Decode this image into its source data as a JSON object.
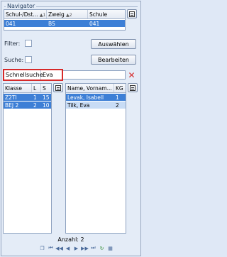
{
  "navigator": {
    "title": "Navigator"
  },
  "top_table": {
    "columns": [
      {
        "label": "Schul-/Dst...",
        "sort": "▲1"
      },
      {
        "label": "Zweig",
        "sort": "▲2"
      },
      {
        "label": "Schule",
        "sort": ""
      }
    ],
    "row": [
      "041",
      "BS",
      "041"
    ]
  },
  "filter": {
    "label": "Filter:",
    "button": "Auswählen"
  },
  "suche": {
    "label": "Suche:",
    "button": "Bearbeiten"
  },
  "schnellsuche": {
    "label": "Schnellsuche",
    "value": "Eva"
  },
  "klassen_table": {
    "columns": [
      {
        "label": "Klasse"
      },
      {
        "label": "L"
      },
      {
        "label": "S"
      }
    ],
    "rows": [
      [
        "Z2TI",
        "1",
        "15"
      ],
      [
        "BEJ 2",
        "2",
        "10"
      ]
    ]
  },
  "schueler_table": {
    "columns": [
      {
        "label": "Name, Vornam..."
      },
      {
        "label": "KG"
      }
    ],
    "rows": [
      [
        "Levak, Isabell",
        "1"
      ],
      [
        "Tilk, Eva",
        "2"
      ]
    ]
  },
  "status": {
    "anzahl": "Anzahl: 2"
  },
  "colors": {
    "selection": "#3d7fd6",
    "selection_light": "#c8dcf5",
    "highlight_border": "#d62a2a"
  }
}
